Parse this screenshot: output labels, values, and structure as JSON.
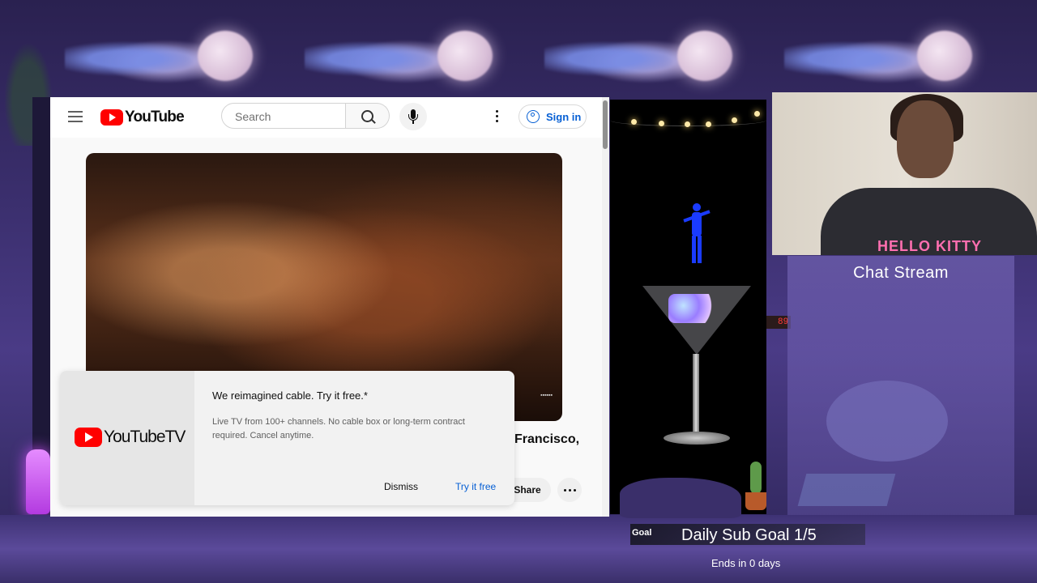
{
  "youtube": {
    "logo_text": "YouTube",
    "search": {
      "placeholder": "Search"
    },
    "sign_in_label": "Sign in",
    "video_title_fragment": "Francisco,",
    "share_label": "Share",
    "promo": {
      "logo_text": "YouTubeTV",
      "headline": "We reimagined cable. Try it free.*",
      "body": "Live TV from 100+ channels. No cable box or long-term contract required. Cancel anytime.",
      "dismiss_label": "Dismiss",
      "try_label": "Try it free"
    }
  },
  "overlay": {
    "chat_title": "Chat Stream",
    "goal": {
      "label": "Goal",
      "text": "Daily Sub Goal 1/5",
      "progress": 0.2,
      "ends": "Ends in 0 days"
    },
    "webcam_shirt_text": "HELLO KITTY"
  },
  "colors": {
    "youtube_red": "#ff0000",
    "link_blue": "#065fd4",
    "stream_purple": "#4a3b86"
  }
}
